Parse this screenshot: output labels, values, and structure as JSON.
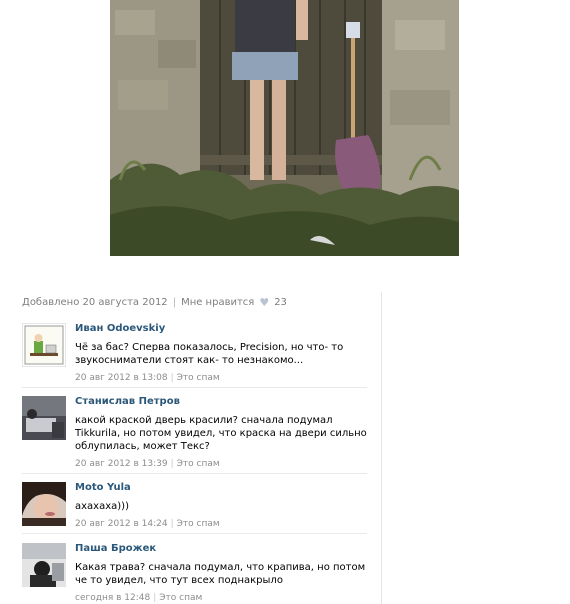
{
  "post": {
    "added_label": "Добавлено 20 августа 2012",
    "like_label": "Мне нравится",
    "like_count": "23"
  },
  "comments": [
    {
      "author": "Иван Odoevskiy",
      "text": "Чё за бас? Сперва показалось, Precision, но что- то звукосниматели стоят как- то незнакомо...",
      "date": "20 авг 2012 в 13:08",
      "spam": "Это спам"
    },
    {
      "author": "Станислав Петров",
      "text": "какой краской дверь красили? сначала подумал Tikkurila, но потом увидел, что краска на двери сильно облупилась, может Текс?",
      "date": "20 авг 2012 в 13:39",
      "spam": "Это спам"
    },
    {
      "author": "Moto Yula",
      "text": "ахахаха)))",
      "date": "20 авг 2012 в 14:24",
      "spam": "Это спам"
    },
    {
      "author": "Паша Брожек",
      "text": "Какая трава? сначала подумал, что крапива, но потом че то увидел, что тут всех поднакрыло",
      "date": "сегодня в 12:48",
      "spam": "Это спам"
    }
  ],
  "icons": {
    "heart": "heart-icon"
  }
}
